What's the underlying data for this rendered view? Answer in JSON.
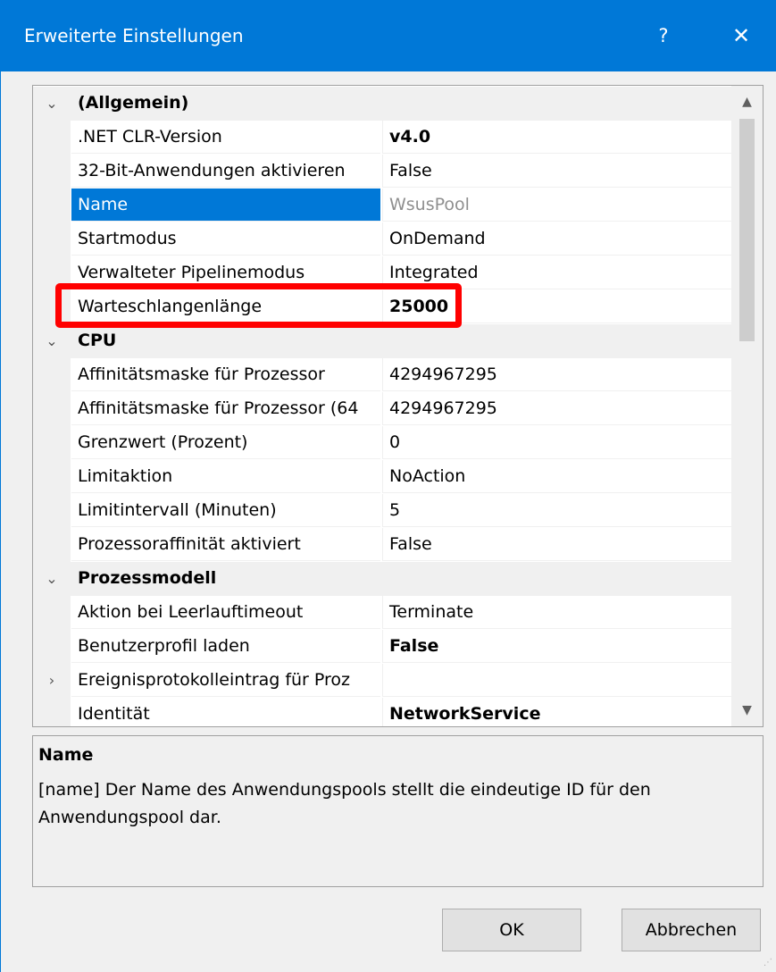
{
  "window": {
    "title": "Erweiterte Einstellungen",
    "help": "?",
    "close": "✕"
  },
  "grid": {
    "rows": [
      {
        "kind": "category",
        "label": "(Allgemein)",
        "toggle": "⌄"
      },
      {
        "kind": "prop",
        "name": ".NET CLR-Version",
        "value": "v4.0",
        "bold": true
      },
      {
        "kind": "prop",
        "name": "32-Bit-Anwendungen aktivieren",
        "value": "False"
      },
      {
        "kind": "prop",
        "name": "Name",
        "value": "WsusPool",
        "selected": true
      },
      {
        "kind": "prop",
        "name": "Startmodus",
        "value": "OnDemand"
      },
      {
        "kind": "prop",
        "name": "Verwalteter Pipelinemodus",
        "value": "Integrated"
      },
      {
        "kind": "prop",
        "name": "Warteschlangenlänge",
        "value": "25000",
        "bold": true
      },
      {
        "kind": "category",
        "label": "CPU",
        "toggle": "⌄"
      },
      {
        "kind": "prop",
        "name": "Affinitätsmaske für Prozessor",
        "value": "4294967295"
      },
      {
        "kind": "prop",
        "name": "Affinitätsmaske für Prozessor (64",
        "value": "4294967295"
      },
      {
        "kind": "prop",
        "name": "Grenzwert (Prozent)",
        "value": "0"
      },
      {
        "kind": "prop",
        "name": "Limitaktion",
        "value": "NoAction"
      },
      {
        "kind": "prop",
        "name": "Limitintervall (Minuten)",
        "value": "5"
      },
      {
        "kind": "prop",
        "name": "Prozessoraffinität aktiviert",
        "value": "False"
      },
      {
        "kind": "category",
        "label": "Prozessmodell",
        "toggle": "⌄"
      },
      {
        "kind": "prop",
        "name": "Aktion bei Leerlauftimeout",
        "value": "Terminate"
      },
      {
        "kind": "prop",
        "name": "Benutzerprofil laden",
        "value": "False",
        "bold": true
      },
      {
        "kind": "prop",
        "name": "Ereignisprotokolleintrag für Proz",
        "value": "",
        "toggle": "›"
      },
      {
        "kind": "prop",
        "name": "Identität",
        "value": "NetworkService",
        "bold": true
      }
    ],
    "scroll_up": "▲",
    "scroll_down": "▼"
  },
  "description": {
    "title": "Name",
    "text": "[name] Der Name des Anwendungspools stellt die eindeutige ID für den Anwendungspool dar."
  },
  "buttons": {
    "ok": "OK",
    "cancel": "Abbrechen"
  },
  "colors": {
    "accent": "#0078d7",
    "highlight": "#ff0000"
  }
}
